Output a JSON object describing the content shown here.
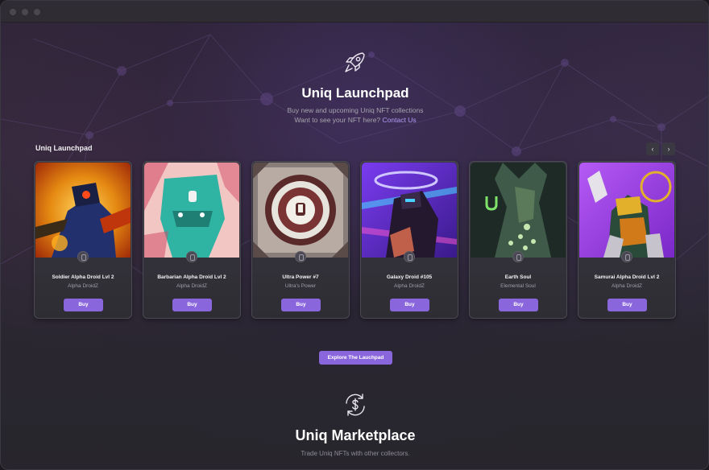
{
  "launchpad": {
    "title": "Uniq Launchpad",
    "subtitle": "Buy new and upcoming Uniq NFT collections",
    "contact_prefix": "Want to see your NFT here?",
    "contact_link": "Contact Us",
    "section_label": "Uniq Launchpad",
    "prev_label": "‹",
    "next_label": "›",
    "icon": "rocket-icon"
  },
  "cards": [
    {
      "name": "Soldier Alpha Droid Lvl 2",
      "collection": "Alpha DroidZ",
      "buy_label": "Buy",
      "palette": [
        "#e8a31b",
        "#c0360c",
        "#2a3a8a"
      ]
    },
    {
      "name": "Barbarian Alpha Droid Lvl 2",
      "collection": "Alpha DroidZ",
      "buy_label": "Buy",
      "palette": [
        "#f2c7c3",
        "#2fb3a3",
        "#d44c6a"
      ]
    },
    {
      "name": "Ultra Power #7",
      "collection": "Ultra's Power",
      "buy_label": "Buy",
      "palette": [
        "#7a6e6e",
        "#e6e2dc",
        "#5a2a2a"
      ]
    },
    {
      "name": "Galaxy Droid #105",
      "collection": "Alpha DroidZ",
      "buy_label": "Buy",
      "palette": [
        "#5a2bd6",
        "#2a1c3a",
        "#e8e0ff"
      ]
    },
    {
      "name": "Earth Soul",
      "collection": "Elemental Soul",
      "buy_label": "Buy",
      "palette": [
        "#2e4a3e",
        "#1e2a26",
        "#7fe36a"
      ]
    },
    {
      "name": "Samurai Alpha Droid Lvl 2",
      "collection": "Alpha DroidZ",
      "buy_label": "Buy",
      "palette": [
        "#9a3ff2",
        "#e2b02a",
        "#c7c3cc"
      ]
    }
  ],
  "explore_label": "Explore The Lauchpad",
  "marketplace": {
    "title": "Uniq Marketplace",
    "subtitle": "Trade Uniq NFTs with other collectors.",
    "icon": "dollar-exchange-icon"
  },
  "colors": {
    "accent": "#8a66dd",
    "link": "#b59cf6",
    "bg": "#2b2930"
  }
}
